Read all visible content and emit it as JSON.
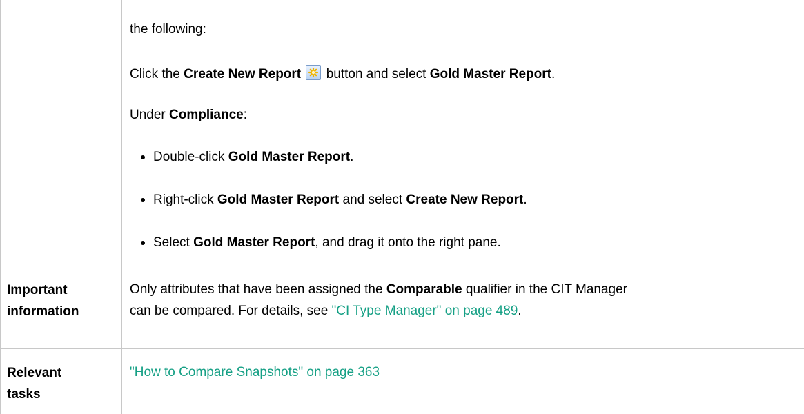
{
  "row1": {
    "line0": "the following:",
    "line1": {
      "pre": "Click the ",
      "b1": "Create New Report",
      "mid": " button and select ",
      "b2": "Gold Master Report",
      "post": "."
    },
    "line2": {
      "pre": "Under ",
      "b1": "Compliance",
      "post": ":"
    },
    "bullets": [
      {
        "pre": "Double-click ",
        "b1": "Gold Master Report",
        "mid": ".",
        "b2": "",
        "post": ""
      },
      {
        "pre": "Right-click ",
        "b1": "Gold Master Report",
        "mid": " and select ",
        "b2": "Create New Report",
        "post": "."
      },
      {
        "pre": "Select ",
        "b1": "Gold Master Report",
        "mid": ", and drag it onto the right pane.",
        "b2": "",
        "post": ""
      }
    ],
    "icon": "create-new-report-icon"
  },
  "row2": {
    "label_line1": "Important",
    "label_line2": "information",
    "text_l1_pre": "Only attributes that have been assigned the ",
    "text_l1_bold": "Comparable",
    "text_l1_post": " qualifier in the CIT Manager",
    "text_l2_pre": "can be compared. For details, see ",
    "text_l2_link": "\"CI Type Manager\" on page 489",
    "text_l2_post": "."
  },
  "row3": {
    "label_line1": "Relevant",
    "label_line2": "tasks",
    "link": "\"How to Compare Snapshots\" on page 363"
  },
  "colors": {
    "border": "#c8c8c8",
    "link": "#16a085"
  }
}
